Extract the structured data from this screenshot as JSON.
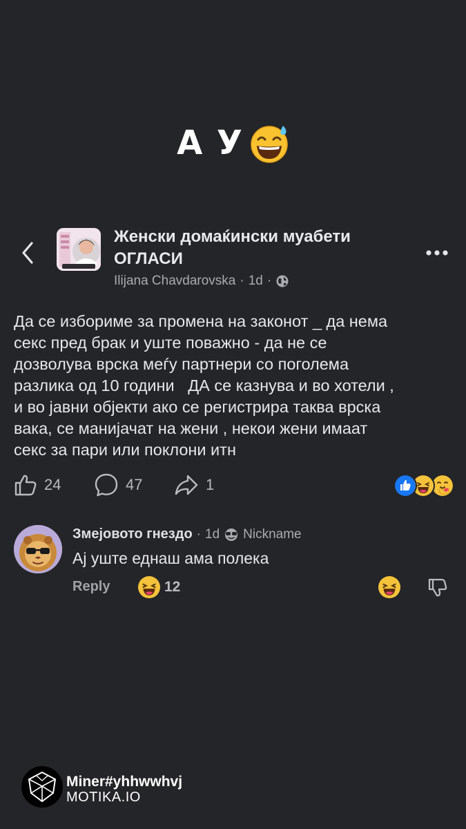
{
  "caption": {
    "text": "А У",
    "emoji_icon": "grinning-sweat-emoji"
  },
  "header": {
    "back_icon": "chevron-left-icon",
    "group_name": "Женски домаќински муабети ОГЛАСИ",
    "author": "Ilijana Chavdarovska",
    "separator": "·",
    "time": "1d",
    "visibility_icon": "globe-icon",
    "more_icon": "more-dots-icon"
  },
  "post": {
    "body": "Да се избориме за промена на законот _ да нема\nсекс пред брак и уште поважно - да не се\nдозволува врска меѓу партнери со поголема\nразлика од 10 години   ДА се казнува и во хотели ,\nи во јавни објекти ако се регистрира таква врска\nвака, се манијачат на жени , некои жени имаат\nсекс за пари или поклони итн"
  },
  "actions": {
    "like_count": "24",
    "comment_count": "47",
    "share_count": "1"
  },
  "reaction_icons": [
    "like-reaction-icon",
    "haha-reaction-icon",
    "care-reaction-icon"
  ],
  "comment": {
    "author": "Змејовото гнездо",
    "separator": "·",
    "time": "1d",
    "badge": "Nickname",
    "badge_icon": "sunglasses-icon",
    "text": "Ај уште еднаш ама полека",
    "reply_label": "Reply",
    "reaction_count": "12"
  },
  "watermark": {
    "line1": "Miner#yhhwwhvj",
    "line2": "MOTIKA.IO"
  },
  "colors": {
    "background": "#242528",
    "text": "#e6e7ea",
    "muted": "#a8abaf",
    "like_blue": "#1877f2",
    "emoji_yellow": "#f5c33b"
  }
}
